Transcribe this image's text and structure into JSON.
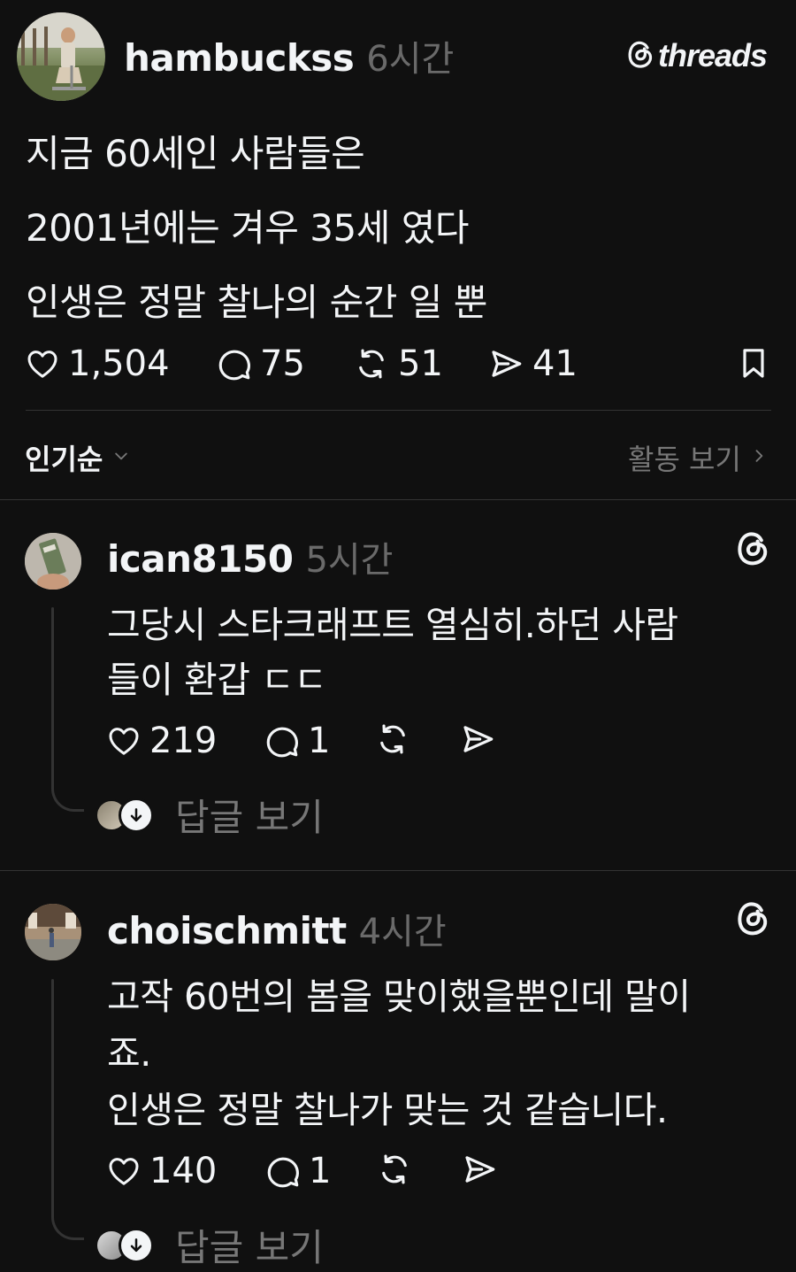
{
  "post": {
    "username": "hambuckss",
    "time": "6시간",
    "brand": "threads",
    "lines": [
      "지금 60세인 사람들은",
      "2001년에는 겨우 35세 였다",
      "인생은 정말 찰나의 순간 일 뿐"
    ],
    "likes": "1,504",
    "comments": "75",
    "reposts": "51",
    "shares": "41"
  },
  "sort": {
    "label": "인기순",
    "activity_label": "활동 보기"
  },
  "replies": [
    {
      "username": "ican8150",
      "time": "5시간",
      "lines": [
        "그당시 스타크래프트 열심히.하던 사람",
        "들이 환갑 ㄷㄷ"
      ],
      "likes": "219",
      "comments": "1",
      "view_replies": "답글 보기"
    },
    {
      "username": "choischmitt",
      "time": "4시간",
      "lines": [
        "고작 60번의 봄을 맞이했을뿐인데 말이",
        "죠.",
        "인생은 정말 찰나가 맞는 것 같습니다."
      ],
      "likes": "140",
      "comments": "1",
      "view_replies": "답글 보기"
    }
  ],
  "colors": {
    "background": "#101010",
    "text": "#f3f5f7",
    "muted": "#777777",
    "divider": "#333333"
  }
}
